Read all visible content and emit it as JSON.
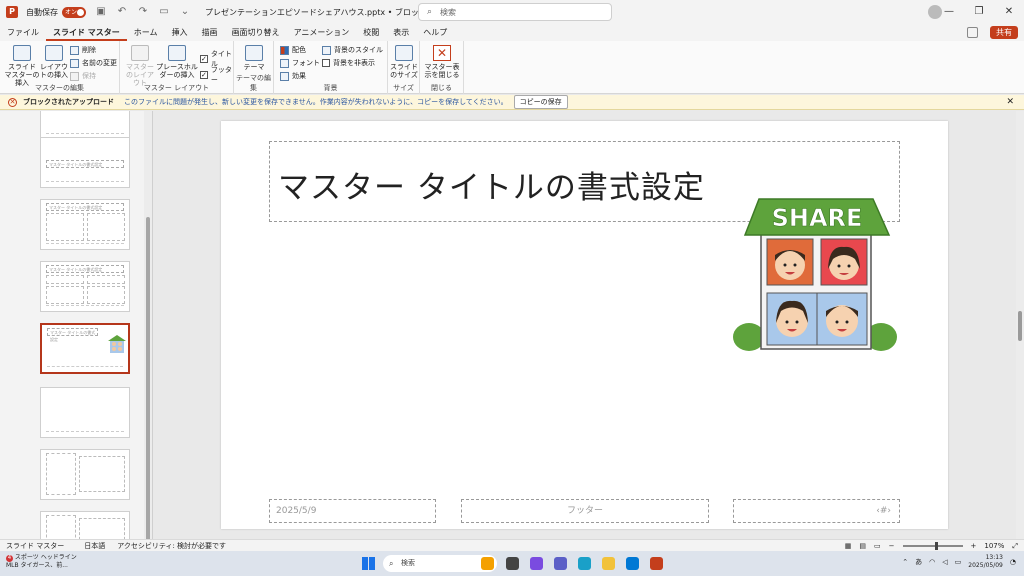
{
  "titlebar": {
    "autosave_label": "自動保存",
    "autosave_state": "オン",
    "doc_title": "プレゼンテーションエピソードシェアハウス.pptx • ブロックされたアップロード ⌄",
    "search_placeholder": "検索",
    "icons": [
      "save-icon",
      "undo-icon",
      "redo-icon",
      "present-icon",
      "customize-icon"
    ]
  },
  "tabs": [
    "ファイル",
    "スライド マスター",
    "ホーム",
    "挿入",
    "描画",
    "画面切り替え",
    "アニメーション",
    "校閲",
    "表示",
    "ヘルプ"
  ],
  "active_tab": "スライド マスター",
  "share_label": "共有",
  "ribbon": {
    "groups": {
      "edit_master": "マスターの編集",
      "master_layout": "マスター レイアウト",
      "edit_theme": "テーマの編集",
      "background": "背景",
      "size": "サイズ",
      "close": "閉じる"
    },
    "buttons": {
      "insert_master": "スライド マスターの挿入",
      "insert_layout": "レイアウトの挿入",
      "delete": "削除",
      "rename": "名前の変更",
      "preserve": "保持",
      "master_layout": "マスターのレイアウト",
      "insert_placeholder": "プレースホルダーの挿入",
      "title_check": "タイトル",
      "footer_check": "フッター",
      "themes": "テーマ",
      "colors": "配色",
      "fonts": "フォント",
      "effects": "効果",
      "bg_styles": "背景のスタイル",
      "hide_bg": "背景を非表示",
      "slide_size": "スライドのサイズ",
      "close_master": "マスター表示を閉じる"
    }
  },
  "message_bar": {
    "title": "ブロックされたアップロード",
    "text": "このファイルに問題が発生し、新しい変更を保存できません。作業内容が失われないように、コピーを保存してください。",
    "button": "コピーの保存"
  },
  "slide": {
    "title": "マスター タイトルの書式設定",
    "date": "2025/5/9",
    "footer": "フッター",
    "page_number": "‹#›",
    "share_sign": "SHARE"
  },
  "thumbnails": {
    "title_text": "マスター タイトルの書式設定"
  },
  "statusbar": {
    "mode": "スライド マスター",
    "language": "日本語",
    "accessibility": "アクセシビリティ: 検討が必要です",
    "zoom": "107%"
  },
  "taskbar": {
    "news_title": "スポーツ ヘッドライン",
    "news_sub": "MLB タイガース、前...",
    "news_badge": "4",
    "search": "検索",
    "time": "13:13",
    "date": "2025/05/09"
  },
  "colors": {
    "accent": "#c43e1c",
    "roof_green": "#5ea33c",
    "house_blue": "#a9c8ea"
  }
}
